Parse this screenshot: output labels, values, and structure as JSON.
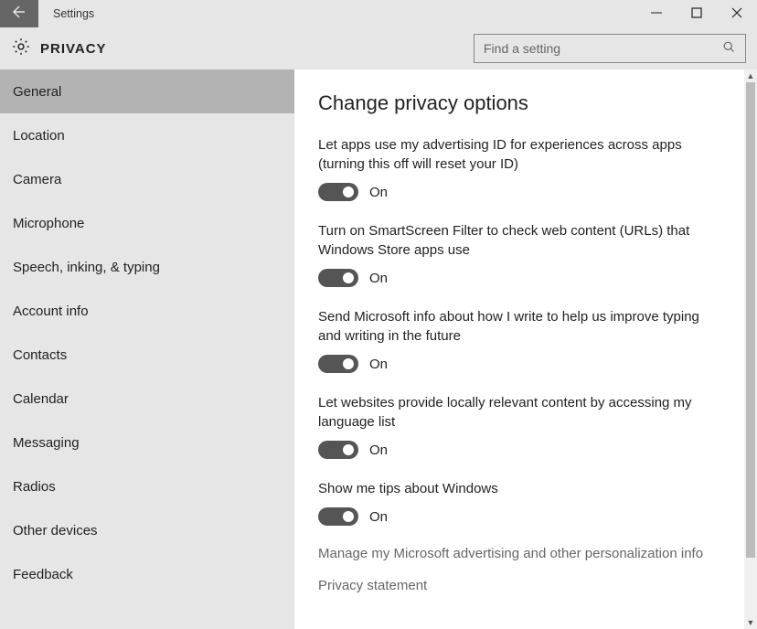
{
  "window": {
    "title": "Settings"
  },
  "header": {
    "section": "PRIVACY",
    "search_placeholder": "Find a setting"
  },
  "sidebar": {
    "items": [
      {
        "label": "General",
        "selected": true
      },
      {
        "label": "Location",
        "selected": false
      },
      {
        "label": "Camera",
        "selected": false
      },
      {
        "label": "Microphone",
        "selected": false
      },
      {
        "label": "Speech, inking, & typing",
        "selected": false
      },
      {
        "label": "Account info",
        "selected": false
      },
      {
        "label": "Contacts",
        "selected": false
      },
      {
        "label": "Calendar",
        "selected": false
      },
      {
        "label": "Messaging",
        "selected": false
      },
      {
        "label": "Radios",
        "selected": false
      },
      {
        "label": "Other devices",
        "selected": false
      },
      {
        "label": "Feedback",
        "selected": false
      }
    ]
  },
  "main": {
    "title": "Change privacy options",
    "options": [
      {
        "label": "Let apps use my advertising ID for experiences across apps (turning this off will reset your ID)",
        "state": "On"
      },
      {
        "label": "Turn on SmartScreen Filter to check web content (URLs) that Windows Store apps use",
        "state": "On"
      },
      {
        "label": "Send Microsoft info about how I write to help us improve typing and writing in the future",
        "state": "On"
      },
      {
        "label": "Let websites provide locally relevant content by accessing my language list",
        "state": "On"
      },
      {
        "label": "Show me tips about Windows",
        "state": "On"
      }
    ],
    "links": [
      "Manage my Microsoft advertising and other personalization info",
      "Privacy statement"
    ]
  }
}
